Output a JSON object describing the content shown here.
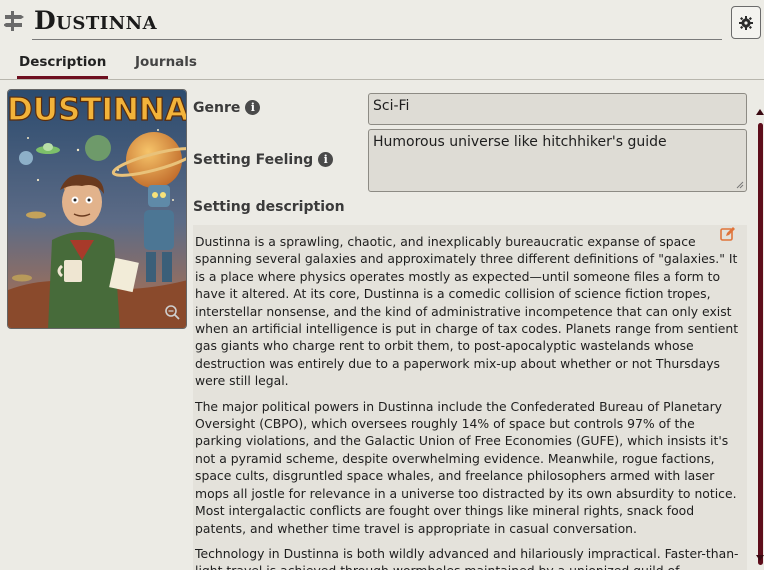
{
  "header": {
    "title": "Dustinna",
    "drag_icon": "drag-handle-icon",
    "settings_icon": "gear-icon"
  },
  "tabs": [
    {
      "label": "Description",
      "active": true
    },
    {
      "label": "Journals",
      "active": false
    }
  ],
  "cover": {
    "title_text": "DUSTINNA",
    "zoom_icon": "zoom-icon"
  },
  "fields": {
    "genre": {
      "label": "Genre",
      "value": "Sci-Fi"
    },
    "setting_feeling": {
      "label": "Setting Feeling",
      "value": "Humorous universe like hitchhiker's guide"
    },
    "setting_description": {
      "label": "Setting description"
    }
  },
  "description": {
    "paragraphs": [
      "Dustinna is a sprawling, chaotic, and inexplicably bureaucratic expanse of space spanning several galaxies and approximately three different definitions of \"galaxies.\" It is a place where physics operates mostly as expected—until someone files a form to have it altered. At its core, Dustinna is a comedic collision of science fiction tropes, interstellar nonsense, and the kind of administrative incompetence that can only exist when an artificial intelligence is put in charge of tax codes. Planets range from sentient gas giants who charge rent to orbit them, to post-apocalyptic wastelands whose destruction was entirely due to a paperwork mix-up about whether or not Thursdays were still legal.",
      "The major political powers in Dustinna include the Confederated Bureau of Planetary Oversight (CBPO), which oversees roughly 14% of space but controls 97% of the parking violations, and the Galactic Union of Free Economies (GUFE), which insists it's not a pyramid scheme, despite overwhelming evidence. Meanwhile, rogue factions, space cults, disgruntled space whales, and freelance philosophers armed with laser mops all jostle for relevance in a universe too distracted by its own absurdity to notice. Most intergalactic conflicts are fought over things like mineral rights, snack food patents, and whether time travel is appropriate in casual conversation.",
      "Technology in Dustinna is both wildly advanced and hilariously impractical. Faster-than-light travel is achieved through wormholes maintained by a unionized guild of teleportation"
    ],
    "edit_icon": "edit-icon"
  },
  "colors": {
    "accent": "#6e1020",
    "background": "#ecebe5",
    "field_bg": "#dedcd5"
  }
}
